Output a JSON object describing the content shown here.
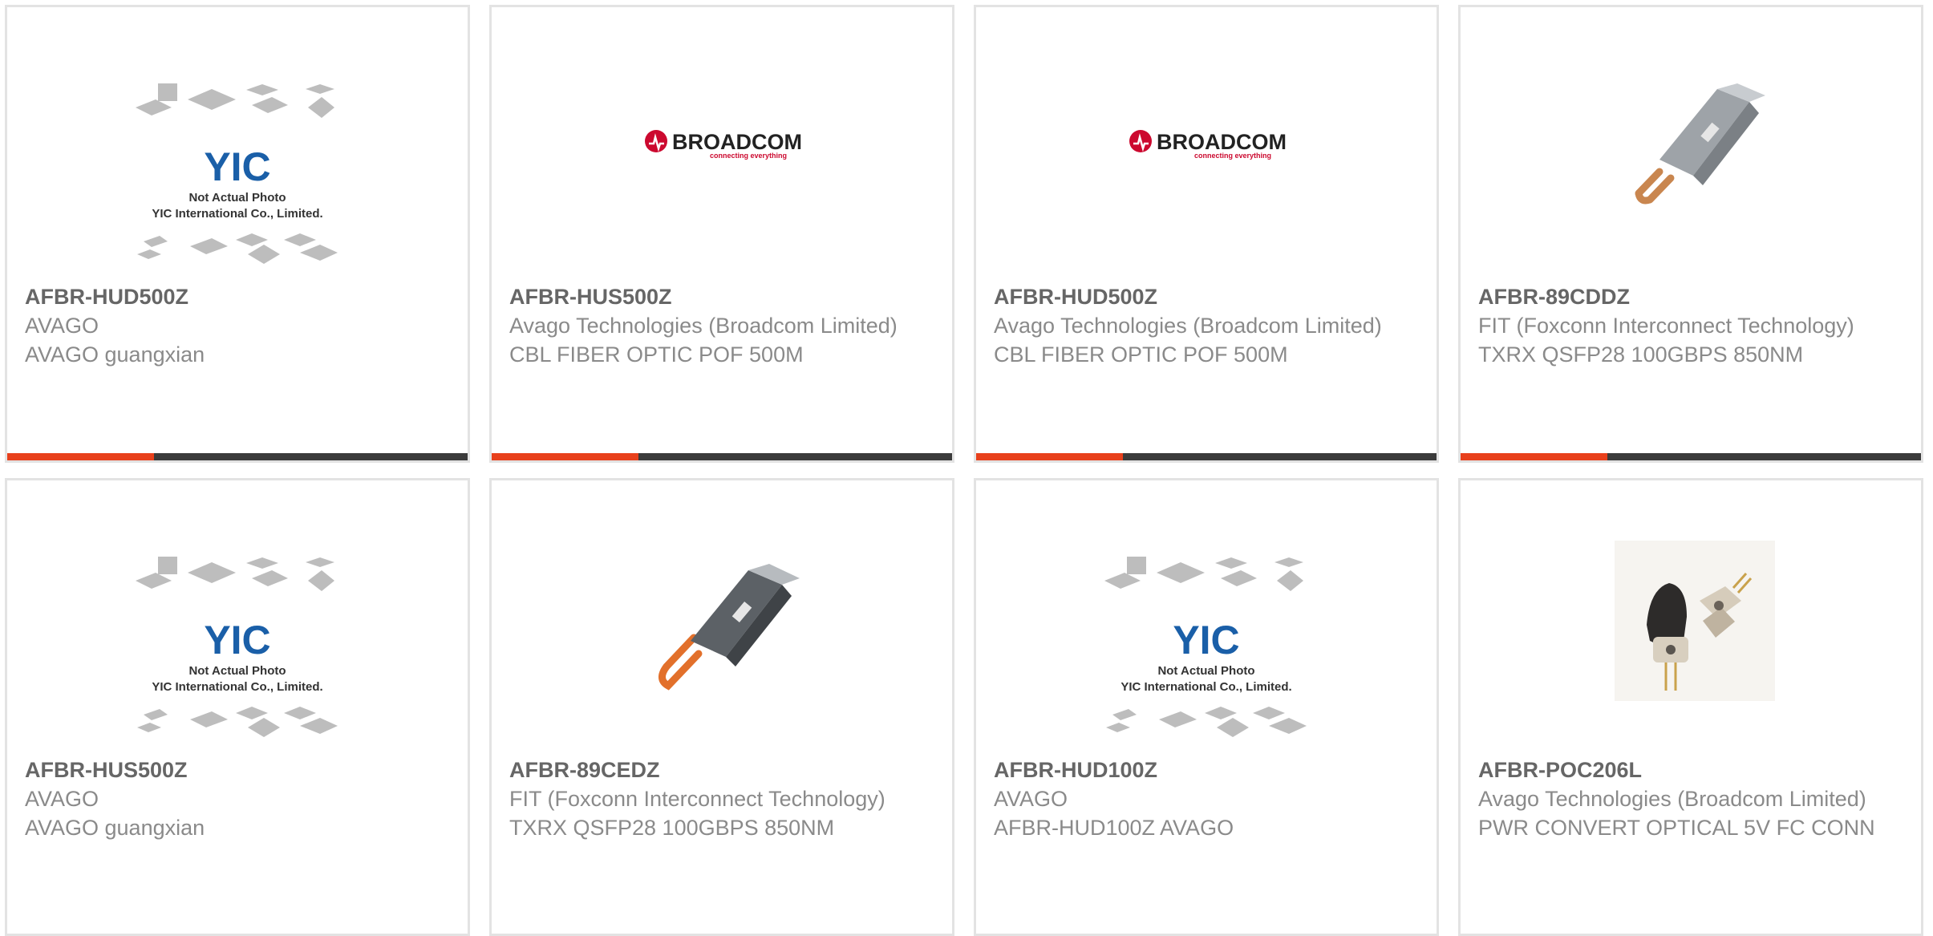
{
  "products": [
    {
      "part": "AFBR-HUD500Z",
      "mfr": "AVAGO",
      "desc": "AVAGO guangxian",
      "image": "yic-placeholder"
    },
    {
      "part": "AFBR-HUS500Z",
      "mfr": "Avago Technologies (Broadcom Limited)",
      "desc": "CBL FIBER OPTIC POF 500M",
      "image": "broadcom-logo"
    },
    {
      "part": "AFBR-HUD500Z",
      "mfr": "Avago Technologies (Broadcom Limited)",
      "desc": "CBL FIBER OPTIC POF 500M",
      "image": "broadcom-logo"
    },
    {
      "part": "AFBR-89CDDZ",
      "mfr": "FIT (Foxconn Interconnect Technology)",
      "desc": "TXRX QSFP28 100GBPS 850NM",
      "image": "qsfp-module"
    },
    {
      "part": "AFBR-HUS500Z",
      "mfr": "AVAGO",
      "desc": "AVAGO guangxian",
      "image": "yic-placeholder"
    },
    {
      "part": "AFBR-89CEDZ",
      "mfr": "FIT (Foxconn Interconnect Technology)",
      "desc": "TXRX QSFP28 100GBPS 850NM",
      "image": "qsfp-module"
    },
    {
      "part": "AFBR-HUD100Z",
      "mfr": "AVAGO",
      "desc": "AFBR-HUD100Z AVAGO",
      "image": "yic-placeholder"
    },
    {
      "part": "AFBR-POC206L",
      "mfr": "Avago Technologies (Broadcom Limited)",
      "desc": "PWR CONVERT OPTICAL 5V FC CONN",
      "image": "optical-connector"
    }
  ],
  "placeholder": {
    "line1": "Not Actual Photo",
    "line2": "YIC International Co., Limited.",
    "logo": "YIC"
  },
  "broadcom": {
    "wordmark": "BROADCOM",
    "tagline": "connecting everything"
  },
  "colors": {
    "accent": "#e8401c",
    "bar": "#3b3b3b",
    "border": "#e3e3e3",
    "part_text": "#666666",
    "body_text": "#8a8a8a",
    "broadcom_red": "#cc092f",
    "yic_blue": "#1a5fa8"
  }
}
